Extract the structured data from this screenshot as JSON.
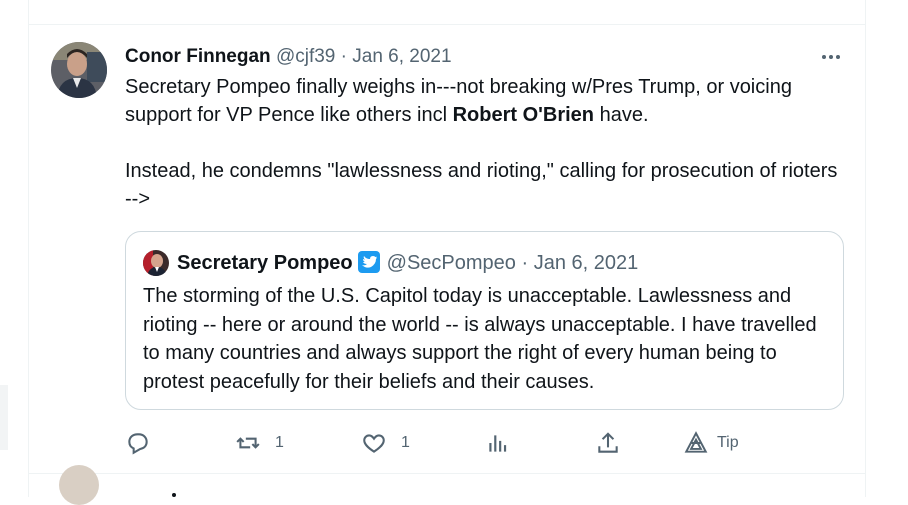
{
  "tweet": {
    "author_name": "Conor Finnegan",
    "handle": "@cjf39",
    "separator": "·",
    "date": "Jan 6, 2021",
    "text_line1_before": "Secretary Pompeo finally weighs in---not breaking w/Pres Trump, or voicing support for VP Pence like others incl ",
    "text_line1_bold": "Robert O'Brien",
    "text_line1_after": " have.",
    "text_para2": "Instead, he condemns \"lawlessness and rioting,\" calling for prosecution of rioters -->",
    "more_icon": "more-dots-icon"
  },
  "quote": {
    "author_name": "Secretary Pompeo",
    "handle": "@SecPompeo",
    "separator": "·",
    "date": "Jan 6, 2021",
    "verified_icon": "verified-badge-icon",
    "text": "The storming of the U.S. Capitol today is unacceptable. Lawlessness and rioting -- here or around the world -- is always unacceptable. I have travelled to many countries and always support the right of every human being to protest peacefully for their beliefs and their causes."
  },
  "actions": {
    "reply_icon": "reply-icon",
    "retweet_icon": "retweet-icon",
    "retweet_count": "1",
    "like_icon": "heart-icon",
    "like_count": "1",
    "views_icon": "views-icon",
    "share_icon": "share-icon",
    "tip_icon": "tip-icon",
    "tip_label": "Tip"
  },
  "colors": {
    "text": "#0f1419",
    "secondary": "#536471",
    "border": "#cfd9de",
    "divider": "#eff3f4",
    "verified": "#1d9bf0"
  }
}
